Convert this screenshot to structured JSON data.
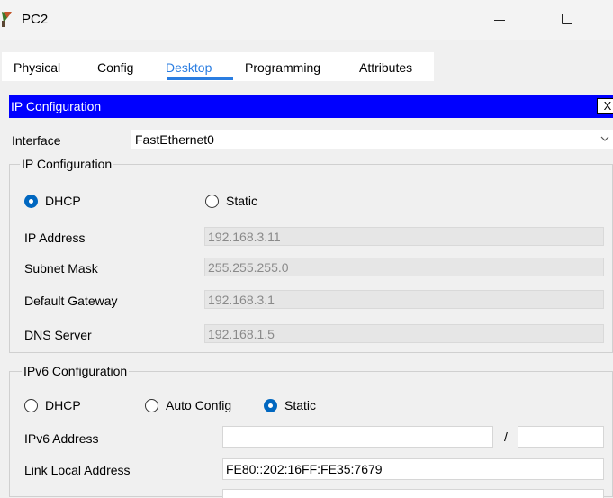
{
  "window": {
    "title": "PC2",
    "app_icon": "packet-tracer-pc-icon"
  },
  "tabs": [
    {
      "label": "Physical",
      "active": false
    },
    {
      "label": "Config",
      "active": false
    },
    {
      "label": "Desktop",
      "active": true
    },
    {
      "label": "Programming",
      "active": false
    },
    {
      "label": "Attributes",
      "active": false
    }
  ],
  "ip_panel": {
    "title": "IP Configuration",
    "close_label": "X",
    "interface_label": "Interface",
    "interface_value": "FastEthernet0",
    "ipv4": {
      "group_label": "IP Configuration",
      "mode_options": [
        "DHCP",
        "Static"
      ],
      "selected_mode": "DHCP",
      "fields": [
        {
          "label": "IP Address",
          "value": "192.168.3.11"
        },
        {
          "label": "Subnet Mask",
          "value": "255.255.255.0"
        },
        {
          "label": "Default Gateway",
          "value": "192.168.3.1"
        },
        {
          "label": "DNS Server",
          "value": "192.168.1.5"
        }
      ]
    },
    "ipv6": {
      "group_label": "IPv6 Configuration",
      "mode_options": [
        "DHCP",
        "Auto Config",
        "Static"
      ],
      "selected_mode": "Static",
      "address_label": "IPv6 Address",
      "address_value": "",
      "prefix_separator": "/",
      "prefix_value": "",
      "link_local_label": "Link Local Address",
      "link_local_value": "FE80::202:16FF:FE35:7679"
    }
  },
  "colors": {
    "accent_tab": "#2a7de1",
    "header_blue": "#0000ff",
    "radio_selected": "#0067c0"
  }
}
